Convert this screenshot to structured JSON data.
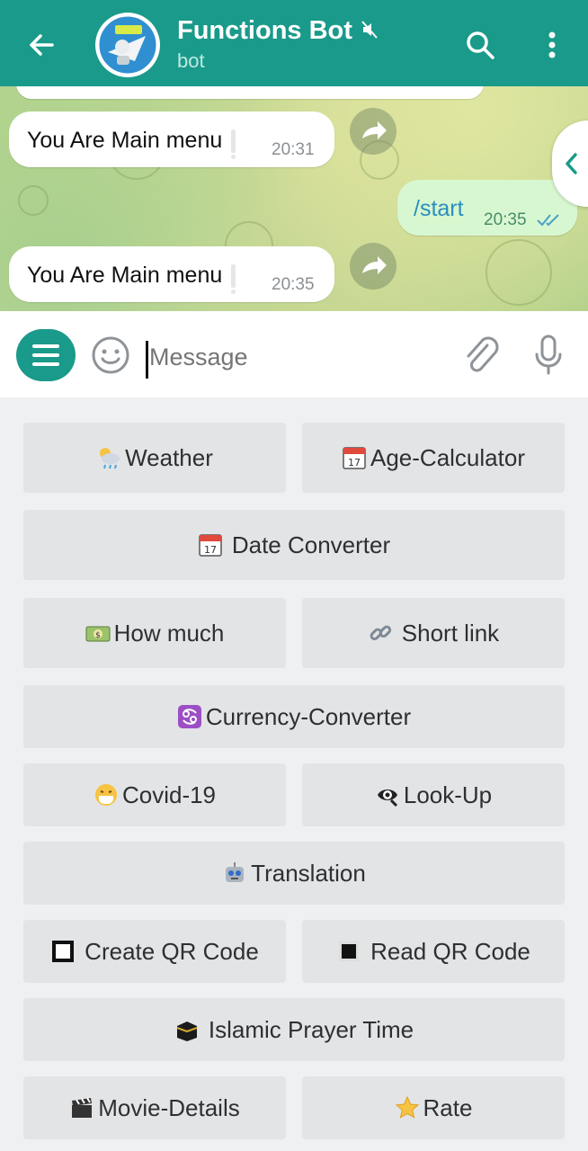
{
  "header": {
    "title": "Functions Bot",
    "subtitle": "bot"
  },
  "messages": [
    {
      "text": "You Are Main menu",
      "time": "20:31",
      "direction": "in"
    },
    {
      "text": "/start",
      "time": "20:35",
      "direction": "out"
    },
    {
      "text": "You Are Main menu",
      "time": "20:35",
      "direction": "in"
    }
  ],
  "input": {
    "placeholder": "Message"
  },
  "keyboard": {
    "weather": "Weather",
    "age_calculator": "Age-Calculator",
    "date_converter": "Date Converter",
    "how_much": "How much",
    "short_link": "Short link",
    "currency_converter": "Currency-Converter",
    "covid": "Covid-19",
    "look_up": "Look-Up",
    "translation": "Translation",
    "create_qr": "Create QR Code",
    "read_qr": "Read QR Code",
    "prayer_time": "Islamic Prayer Time",
    "movie_details": "Movie-Details",
    "rate": "Rate"
  },
  "icons": {
    "back": "arrow-left-icon",
    "muted": "mute-icon",
    "search": "search-icon",
    "more": "more-vert-icon",
    "menu": "menu-icon",
    "emoji": "emoji-icon",
    "attach": "paperclip-icon",
    "mic": "microphone-icon",
    "share": "share-arrow-icon"
  },
  "colors": {
    "header": "#1a9a8a",
    "out_bubble": "#d7f7d0",
    "link": "#2a8fbd"
  }
}
